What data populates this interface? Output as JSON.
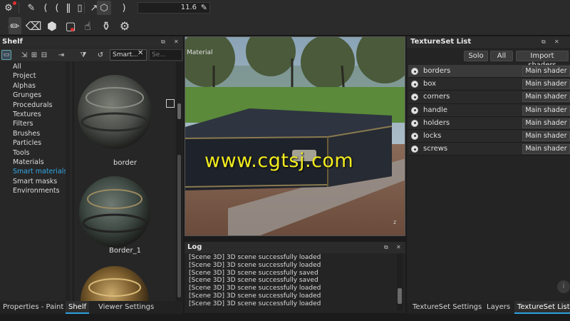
{
  "toolbar": {
    "row1_icons": [
      "brush-settings-icon",
      "pipette-icon",
      "symmetry-icon",
      "bracket-left-icon",
      "bracket-x-icon",
      "bracket-right-icon",
      "camera-icon",
      "cube-icon",
      "bracket-close-icon"
    ],
    "brush_size": "11.6",
    "row2_icons": [
      "paint-brush-icon",
      "eraser-icon",
      "projection-icon",
      "polygon-fill-icon",
      "smudge-icon",
      "clone-stamp-icon",
      "material-picker-icon"
    ]
  },
  "shelf": {
    "title": "Shelf",
    "tab_label": "Smart...",
    "search_placeholder": "Se...",
    "categories": [
      "All",
      "Project",
      "Alphas",
      "Grunges",
      "Procedurals",
      "Textures",
      "Filters",
      "Brushes",
      "Particles",
      "Tools",
      "Materials",
      "Smart materials",
      "Smart masks",
      "Environments"
    ],
    "selected_category": "Smart materials",
    "thumbnails": [
      {
        "label": "border"
      },
      {
        "label": "Border_1"
      },
      {
        "label": ""
      }
    ]
  },
  "left_bottom_tabs": [
    "Properties - Paint",
    "Shelf",
    "Viewer Settings"
  ],
  "left_bottom_active": "Shelf",
  "viewport": {
    "label": "Material",
    "watermark": "www.cgtsj.com",
    "axis_label": "z"
  },
  "log": {
    "title": "Log",
    "lines": [
      "[Scene 3D] 3D scene successfully loaded",
      "[Scene 3D] 3D scene successfully loaded",
      "[Scene 3D] 3D scene successfully saved",
      "[Scene 3D] 3D scene successfully saved",
      "[Scene 3D] 3D scene successfully loaded",
      "[Scene 3D] 3D scene successfully loaded",
      "[Scene 3D] 3D scene successfully loaded"
    ]
  },
  "texture_set_list": {
    "title": "TextureSet List",
    "buttons": {
      "solo": "Solo",
      "all": "All",
      "import": "Import shaders"
    },
    "rows": [
      {
        "name": "borders",
        "shader": "Main shader"
      },
      {
        "name": "box",
        "shader": "Main shader"
      },
      {
        "name": "corners",
        "shader": "Main shader"
      },
      {
        "name": "handle",
        "shader": "Main shader"
      },
      {
        "name": "holders",
        "shader": "Main shader"
      },
      {
        "name": "locks",
        "shader": "Main shader"
      },
      {
        "name": "screws",
        "shader": "Main shader"
      }
    ],
    "selected": "borders"
  },
  "right_bottom_tabs": [
    "TextureSet Settings",
    "Layers",
    "TextureSet List"
  ],
  "right_bottom_active": "TextureSet List",
  "colors": {
    "accent": "#31a9e8",
    "watermark": "#f2ec1f"
  }
}
